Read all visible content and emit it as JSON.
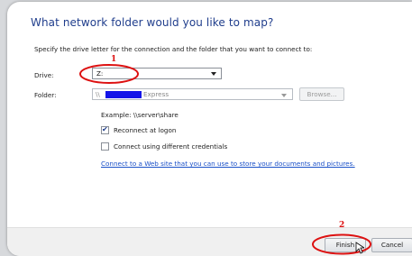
{
  "dialog": {
    "heading": "What network folder would you like to map?",
    "instruction": "Specify the drive letter for the connection and the folder that you want to connect to:"
  },
  "drive": {
    "label": "Drive:",
    "value": "Z:"
  },
  "folder": {
    "label": "Folder:",
    "value_prefix": "\\\\",
    "value_suffix": "Express",
    "browse_label": "Browse..."
  },
  "example_text": "Example: \\\\server\\share",
  "options": {
    "reconnect_label": "Reconnect at logon",
    "reconnect_checked": true,
    "credentials_label": "Connect using different credentials",
    "credentials_checked": false
  },
  "link_text": "Connect to a Web site that you can use to store your documents and pictures.",
  "buttons": {
    "finish": "Finish",
    "cancel": "Cancel"
  },
  "annotations": {
    "step1": "1",
    "step2": "2",
    "color": "#dd1111"
  },
  "colors": {
    "heading": "#1f3d8c",
    "link": "#1a50c8",
    "redaction": "#1414e8"
  }
}
